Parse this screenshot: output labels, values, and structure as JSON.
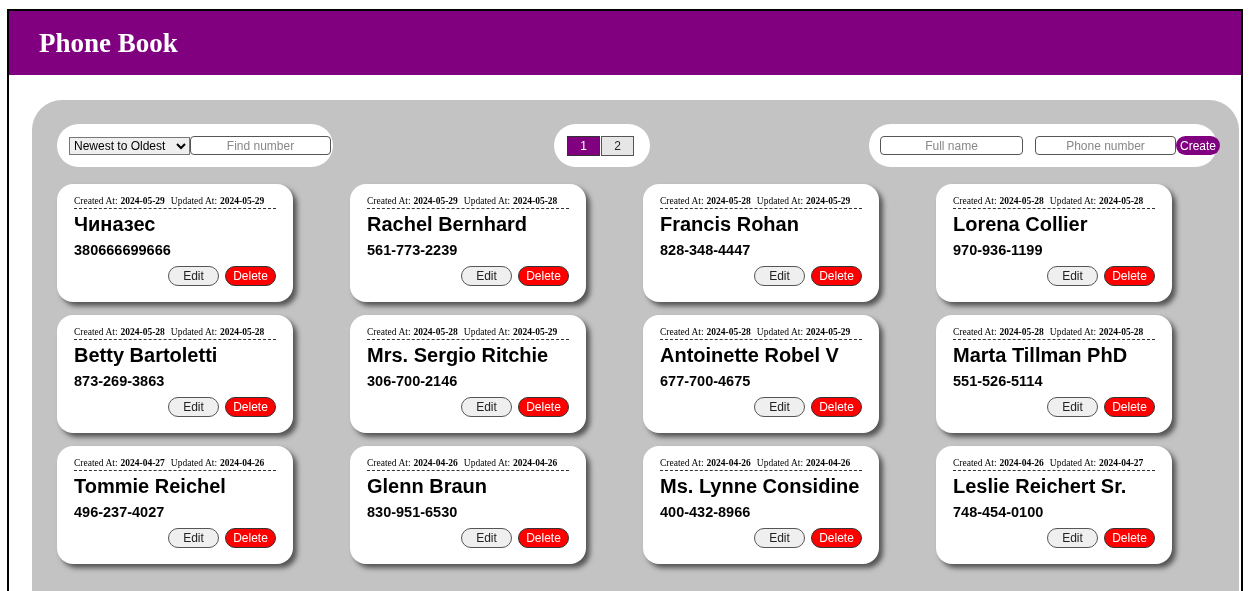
{
  "header": {
    "title": "Phone Book"
  },
  "toolbar": {
    "sort": {
      "value": "Newest to Oldest"
    },
    "search": {
      "placeholder": "Find number"
    },
    "pages": [
      {
        "label": "1",
        "selected": true
      },
      {
        "label": "2",
        "selected": false
      }
    ],
    "name_field": {
      "placeholder": "Full name"
    },
    "phone_field": {
      "placeholder": "Phone number"
    },
    "create_button": "Create"
  },
  "contacts": [
    {
      "created_label": "Created At:",
      "created": "2024-05-29",
      "updated_label": "Updated At:",
      "updated": "2024-05-29",
      "name": "Чиназес",
      "phone": "380666699666",
      "edit": "Edit",
      "delete": "Delete"
    },
    {
      "created_label": "Created At:",
      "created": "2024-05-29",
      "updated_label": "Updated At:",
      "updated": "2024-05-28",
      "name": "Rachel Bernhard",
      "phone": "561-773-2239",
      "edit": "Edit",
      "delete": "Delete"
    },
    {
      "created_label": "Created At:",
      "created": "2024-05-28",
      "updated_label": "Updated At:",
      "updated": "2024-05-29",
      "name": "Francis Rohan",
      "phone": "828-348-4447",
      "edit": "Edit",
      "delete": "Delete"
    },
    {
      "created_label": "Created At:",
      "created": "2024-05-28",
      "updated_label": "Updated At:",
      "updated": "2024-05-28",
      "name": "Lorena Collier",
      "phone": "970-936-1199",
      "edit": "Edit",
      "delete": "Delete"
    },
    {
      "created_label": "Created At:",
      "created": "2024-05-28",
      "updated_label": "Updated At:",
      "updated": "2024-05-28",
      "name": "Betty Bartoletti",
      "phone": "873-269-3863",
      "edit": "Edit",
      "delete": "Delete"
    },
    {
      "created_label": "Created At:",
      "created": "2024-05-28",
      "updated_label": "Updated At:",
      "updated": "2024-05-29",
      "name": "Mrs. Sergio Ritchie",
      "phone": "306-700-2146",
      "edit": "Edit",
      "delete": "Delete"
    },
    {
      "created_label": "Created At:",
      "created": "2024-05-28",
      "updated_label": "Updated At:",
      "updated": "2024-05-29",
      "name": "Antoinette Robel V",
      "phone": "677-700-4675",
      "edit": "Edit",
      "delete": "Delete"
    },
    {
      "created_label": "Created At:",
      "created": "2024-05-28",
      "updated_label": "Updated At:",
      "updated": "2024-05-28",
      "name": "Marta Tillman PhD",
      "phone": "551-526-5114",
      "edit": "Edit",
      "delete": "Delete"
    },
    {
      "created_label": "Created At:",
      "created": "2024-04-27",
      "updated_label": "Updated At:",
      "updated": "2024-04-26",
      "name": "Tommie Reichel",
      "phone": "496-237-4027",
      "edit": "Edit",
      "delete": "Delete"
    },
    {
      "created_label": "Created At:",
      "created": "2024-04-26",
      "updated_label": "Updated At:",
      "updated": "2024-04-26",
      "name": "Glenn Braun",
      "phone": "830-951-6530",
      "edit": "Edit",
      "delete": "Delete"
    },
    {
      "created_label": "Created At:",
      "created": "2024-04-26",
      "updated_label": "Updated At:",
      "updated": "2024-04-26",
      "name": "Ms. Lynne Considine",
      "phone": "400-432-8966",
      "edit": "Edit",
      "delete": "Delete"
    },
    {
      "created_label": "Created At:",
      "created": "2024-04-26",
      "updated_label": "Updated At:",
      "updated": "2024-04-27",
      "name": "Leslie Reichert Sr.",
      "phone": "748-454-0100",
      "edit": "Edit",
      "delete": "Delete"
    }
  ]
}
